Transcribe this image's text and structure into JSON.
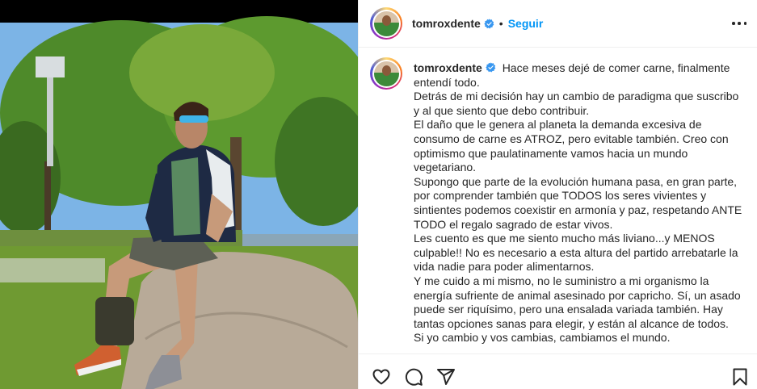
{
  "post": {
    "username": "tomroxdente",
    "dot": "•",
    "follow_label": "Seguir",
    "caption": "Hace meses dejé de comer carne, finalmente\nentendí todo.\nDetrás de mi decisión hay un cambio de paradigma que suscribo\ny al que siento que debo contribuir.\nEl daño que le genera al planeta la demanda excesiva de\nconsumo de carne es ATROZ, pero evitable también. Creo con\noptimismo que paulatinamente vamos hacia un mundo\nvegetariano.\nSupongo que parte de la evolución humana pasa, en gran parte,\npor comprender también que TODOS los seres vivientes y\nsintientes podemos coexistir en armonía y paz, respetando ANTE\nTODO el regalo sagrado de estar vivos.\nLes cuento es que me siento mucho más liviano...y MENOS\nculpable!! No es necesario a esta altura del partido arrebatarle la\nvida nadie para poder alimentarnos.\nY me cuido a mi mismo, no le suministro a mi organismo la\nenergía sufriente de animal asesinado por capricho. Sí, un asado\npuede ser riquísimo, pero una ensalada variada también. Hay\ntantas opciones sanas para elegir, y están al alcance de todos.\nSi yo cambio y vos cambias, cambiamos el mundo."
  },
  "icons": {
    "verified": "verified-badge-icon",
    "more": "more-options-icon",
    "like": "heart-icon",
    "comment": "comment-icon",
    "share": "share-icon",
    "save": "bookmark-icon"
  },
  "colors": {
    "accent_blue": "#0095f6",
    "verified_blue": "#3897f0",
    "text": "#262626",
    "divider": "#efefef"
  }
}
